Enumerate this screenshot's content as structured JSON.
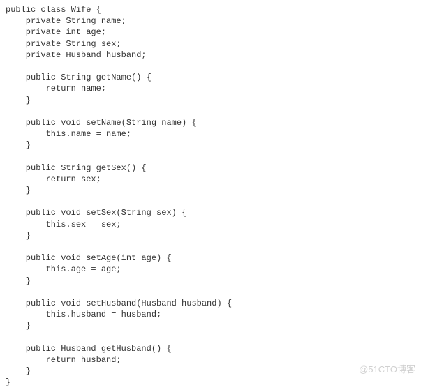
{
  "code": {
    "lines": [
      "public class Wife {",
      "    private String name;",
      "    private int age;",
      "    private String sex;",
      "    private Husband husband;",
      "",
      "    public String getName() {",
      "        return name;",
      "    }",
      "",
      "    public void setName(String name) {",
      "        this.name = name;",
      "    }",
      "",
      "    public String getSex() {",
      "        return sex;",
      "    }",
      "",
      "    public void setSex(String sex) {",
      "        this.sex = sex;",
      "    }",
      "",
      "    public void setAge(int age) {",
      "        this.age = age;",
      "    }",
      "",
      "    public void setHusband(Husband husband) {",
      "        this.husband = husband;",
      "    }",
      "",
      "    public Husband getHusband() {",
      "        return husband;",
      "    }",
      "}"
    ]
  },
  "watermark": "@51CTO博客"
}
